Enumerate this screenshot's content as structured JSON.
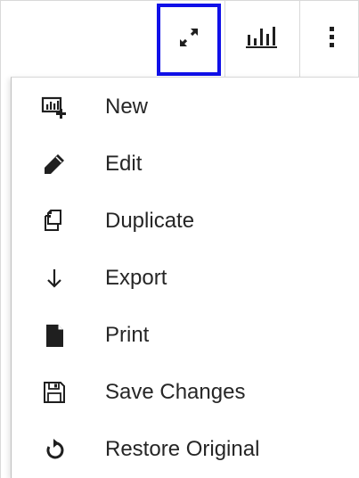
{
  "toolbar": {
    "buttons": [
      {
        "name": "expand",
        "icon": "expand-arrows-icon",
        "selected": true
      },
      {
        "name": "chart",
        "icon": "bar-chart-icon"
      },
      {
        "name": "more",
        "icon": "vertical-ellipsis-icon"
      }
    ],
    "highlight_color": "#1010e8"
  },
  "menu": {
    "items": [
      {
        "label": "New",
        "icon": "new-chart-icon"
      },
      {
        "label": "Edit",
        "icon": "pencil-icon"
      },
      {
        "label": "Duplicate",
        "icon": "duplicate-icon"
      },
      {
        "label": "Export",
        "icon": "down-arrow-icon"
      },
      {
        "label": "Print",
        "icon": "document-icon"
      },
      {
        "label": "Save Changes",
        "icon": "floppy-disk-icon"
      },
      {
        "label": "Restore Original",
        "icon": "restore-icon"
      }
    ]
  },
  "colors": {
    "text": "#262626",
    "icon": "#1f1f1f",
    "border": "#d9d9d9"
  }
}
